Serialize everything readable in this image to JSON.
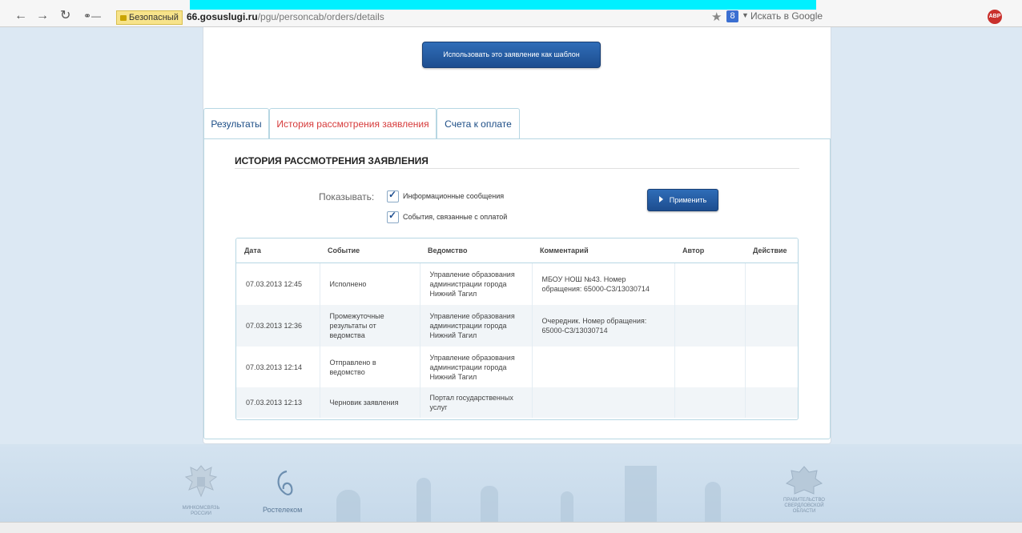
{
  "browser": {
    "secure_label": "Безопасный",
    "url_host": "66.gosuslugi.ru",
    "url_path": "/pgu/personcab/orders/details",
    "search_placeholder": "Искать в Google",
    "search_badge": "8",
    "adblock_label": "ABP"
  },
  "page": {
    "template_button": "Использовать это заявление как шаблон",
    "tabs": [
      {
        "label": "Результаты",
        "active": false
      },
      {
        "label": "История рассмотрения заявления",
        "active": true
      },
      {
        "label": "Счета к оплате",
        "active": false
      }
    ],
    "section_title": "ИСТОРИЯ РАССМОТРЕНИЯ ЗАЯВЛЕНИЯ",
    "filter": {
      "show_label": "Показывать:",
      "options": [
        {
          "label": "Информационные сообщения",
          "checked": true
        },
        {
          "label": "События, связанные с оплатой",
          "checked": true
        }
      ],
      "apply_button": "Применить"
    },
    "table": {
      "columns": [
        "Дата",
        "Событие",
        "Ведомство",
        "Комментарий",
        "Автор",
        "Действие"
      ],
      "rows": [
        {
          "date": "07.03.2013 12:45",
          "event": "Исполнено",
          "agency": "Управление образования администрации города Нижний Тагил",
          "comment": "МБОУ НОШ №43. Номер обращения: 65000-С3/13030714",
          "author": "",
          "action": ""
        },
        {
          "date": "07.03.2013 12:36",
          "event": "Промежуточные результаты от ведомства",
          "agency": "Управление образования администрации города Нижний Тагил",
          "comment": "Очередник. Номер обращения: 65000-С3/13030714",
          "author": "",
          "action": ""
        },
        {
          "date": "07.03.2013 12:14",
          "event": "Отправлено в ведомство",
          "agency": "Управление образования администрации города Нижний Тагил",
          "comment": "",
          "author": "",
          "action": ""
        },
        {
          "date": "07.03.2013 12:13",
          "event": "Черновик заявления",
          "agency": "Портал государственных услуг",
          "comment": "",
          "author": "",
          "action": ""
        }
      ]
    }
  },
  "footer": {
    "minsvyaz_caption": "МИНКОМСВЯЗЬ РОССИИ",
    "rostelecom": "Ростелеком",
    "gov_caption": "ПРАВИТЕЛЬСТВО СВЕРДЛОВСКОЙ ОБЛАСТИ"
  }
}
